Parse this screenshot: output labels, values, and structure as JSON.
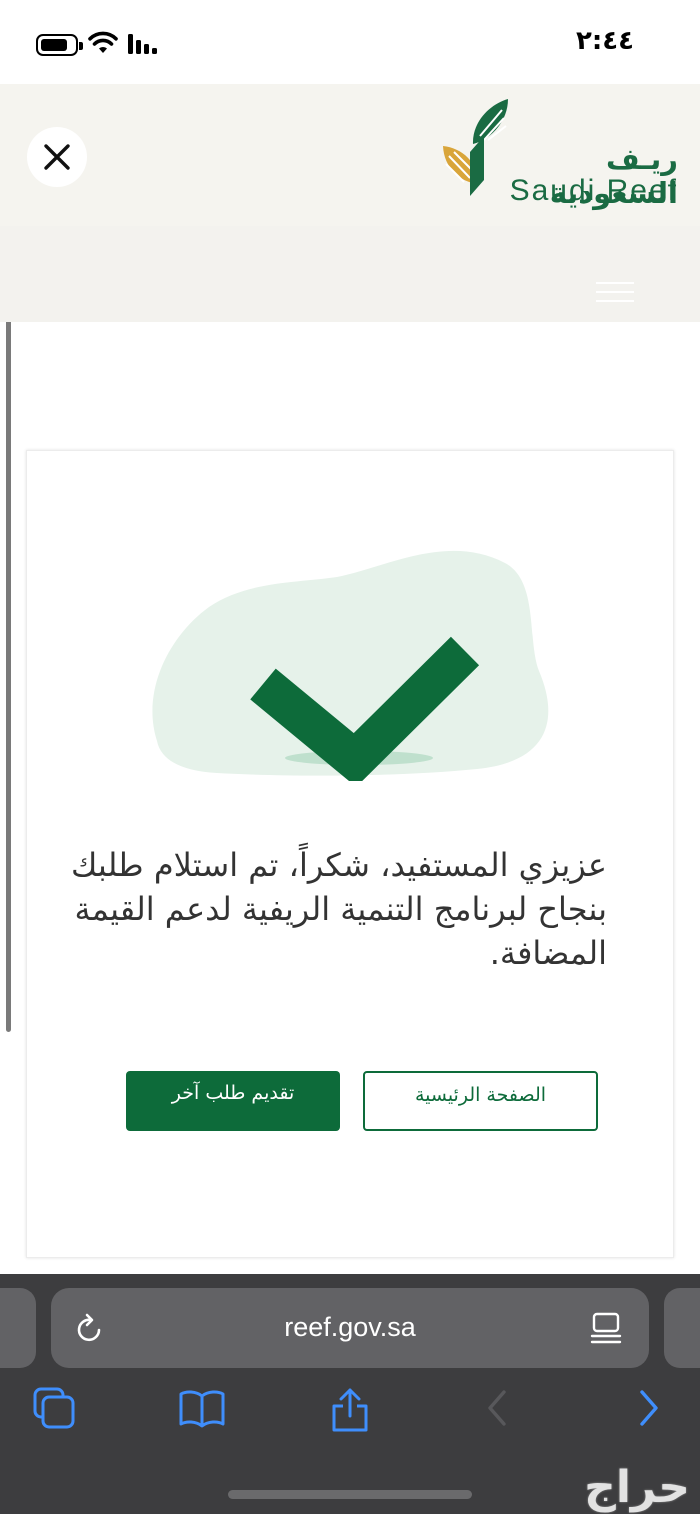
{
  "status_bar": {
    "time": "٢:٤٤"
  },
  "header": {
    "logo_ar": "ريـف السعودية",
    "logo_en": "Saudi Reef",
    "close_icon": "close-icon",
    "menu_icon": "hamburger-menu-icon"
  },
  "confirmation": {
    "message": "عزيزي المستفيد، شكراً، تم استلام طلبك بنجاح لبرنامج التنمية الريفية لدعم القيمة المضافة.",
    "icon": "checkmark-icon",
    "home_button_label": "الصفحة الرئيسية",
    "new_request_button_label": "تقديم طلب آخر"
  },
  "browser": {
    "url": "reef.gov.sa",
    "watermark": "حراج"
  },
  "colors": {
    "brand_green": "#0d6b3a",
    "header_bg": "#f5f4ef",
    "chrome_bg": "#3d3d3f",
    "toolbar_blue": "#3f8efc"
  }
}
